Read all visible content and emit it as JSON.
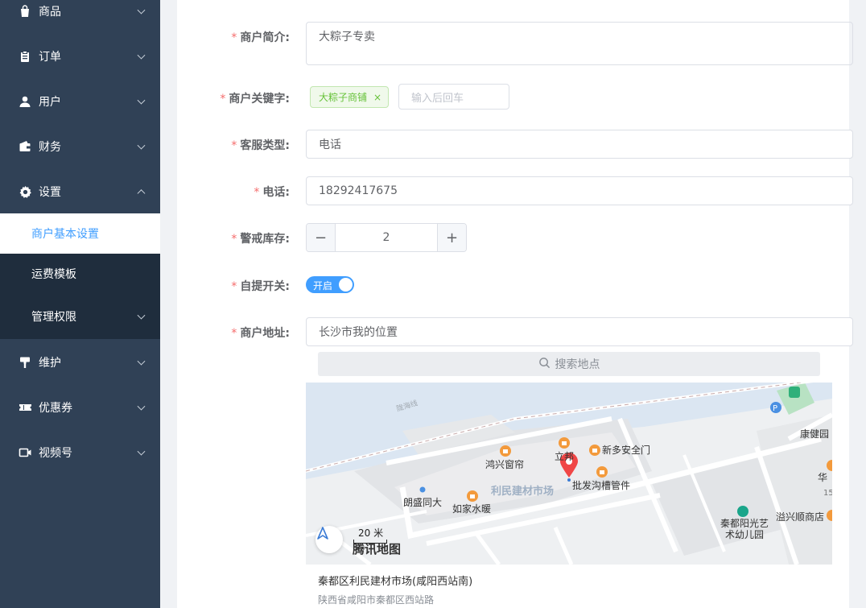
{
  "sidebar": {
    "items": [
      {
        "label": "商品",
        "icon": "shopping-bag-icon"
      },
      {
        "label": "订单",
        "icon": "clipboard-icon"
      },
      {
        "label": "用户",
        "icon": "user-icon"
      },
      {
        "label": "财务",
        "icon": "wallet-icon"
      },
      {
        "label": "设置",
        "icon": "gear-icon"
      },
      {
        "label": "维护",
        "icon": "paint-roller-icon"
      },
      {
        "label": "优惠券",
        "icon": "ticket-icon"
      },
      {
        "label": "视频号",
        "icon": "video-icon"
      }
    ],
    "sub_items": [
      {
        "label": "商户基本设置",
        "active": true
      },
      {
        "label": "运费模板",
        "active": false
      },
      {
        "label": "管理权限",
        "active": false
      }
    ]
  },
  "form": {
    "intro": {
      "label": "商户简介:",
      "value": "大粽子专卖"
    },
    "keywords": {
      "label": "商户关键字:",
      "tag": "大粽子商铺",
      "tag_close": "×",
      "placeholder": "输入后回车"
    },
    "service_type": {
      "label": "客服类型:",
      "value": "电话"
    },
    "phone": {
      "label": "电话:",
      "value": "18292417675"
    },
    "stock_alert": {
      "label": "警戒库存:",
      "value": "2",
      "minus": "−",
      "plus": "+"
    },
    "pickup": {
      "label": "自提开关:",
      "switch_text": "开启",
      "on": true
    },
    "address": {
      "label": "商户地址:",
      "value": "长沙市我的位置"
    },
    "required_mark": "*"
  },
  "map": {
    "search_placeholder": "搜索地点",
    "road_label": "陇海线",
    "area_label": "利民建材市场",
    "pois": [
      "鸿兴窗帘",
      "立邦",
      "新多安全门",
      "批发沟槽管件",
      "朗盛同大",
      "如家水暖",
      "康健园",
      "华",
      "秦都阳光艺术幼儿园",
      "溢兴顺商店",
      "15"
    ],
    "scale": "20 米",
    "brand": "腾讯地图",
    "result_title": "秦都区利民建材市场(咸阳西站南)",
    "result_address": "陕西省咸阳市秦都区西站路"
  },
  "colors": {
    "sidebar_bg": "#304156",
    "sidebar_sub_bg": "#1f2d3d",
    "accent": "#409eff",
    "required": "#f56c6c",
    "tag_green": "#67c23a"
  }
}
